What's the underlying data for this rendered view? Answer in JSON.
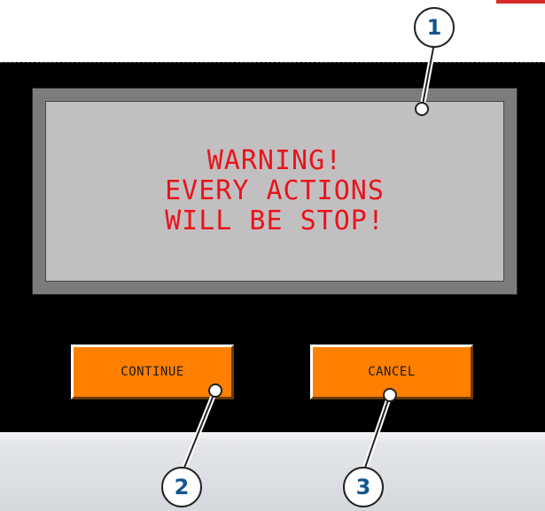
{
  "warning_panel": {
    "lines": [
      "WARNING!",
      "EVERY ACTIONS",
      "WILL BE STOP!"
    ]
  },
  "buttons": {
    "continue_label": "CONTINUE",
    "cancel_label": "CANCEL"
  },
  "callouts": [
    "1",
    "2",
    "3"
  ],
  "colors": {
    "screen_bg": "#000000",
    "panel_bg": "#c2bfc1",
    "panel_frame": "#7c7c7c",
    "warning_text": "#e8141b",
    "button_bg": "#ff7f00",
    "callout_text": "#13568f"
  }
}
